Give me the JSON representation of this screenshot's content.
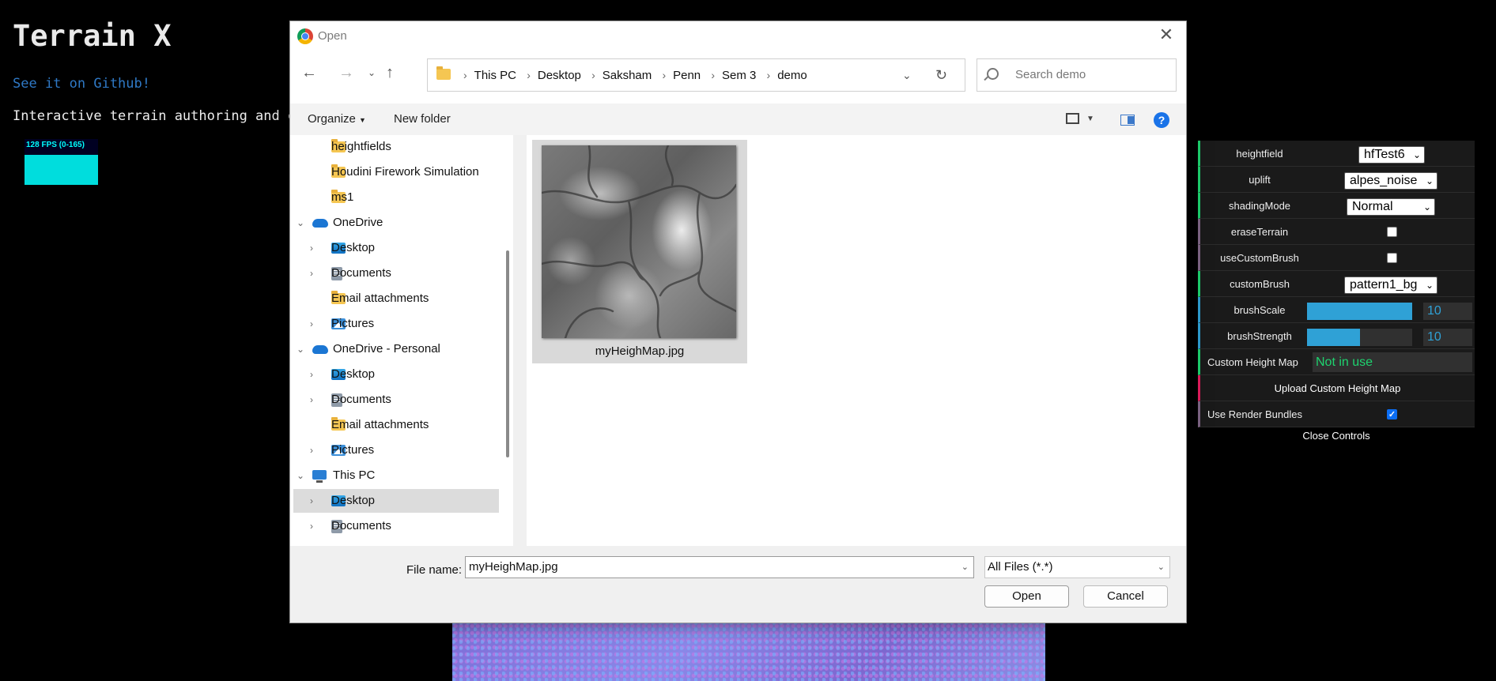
{
  "page": {
    "title": "Terrain X",
    "github_link": "See it on Github!",
    "description": "Interactive terrain authoring and e",
    "fps": "128 FPS (0-165)"
  },
  "controls": {
    "rows": {
      "heightfield": {
        "label": "heightfield",
        "value": "hfTest6"
      },
      "uplift": {
        "label": "uplift",
        "value": "alpes_noise"
      },
      "shadingMode": {
        "label": "shadingMode",
        "value": "Normal"
      },
      "eraseTerrain": {
        "label": "eraseTerrain",
        "checked": false
      },
      "useCustomBrush": {
        "label": "useCustomBrush",
        "checked": false
      },
      "customBrush": {
        "label": "customBrush",
        "value": "pattern1_bg"
      },
      "brushScale": {
        "label": "brushScale",
        "value": "10",
        "fill": 1.0
      },
      "brushStrength": {
        "label": "brushStrength",
        "value": "10",
        "fill": 0.5
      },
      "customHeightMap": {
        "label": "Custom Height Map",
        "value": "Not in use"
      },
      "uploadCustomHeightMap": {
        "label": "Upload Custom Height Map"
      },
      "useRenderBundles": {
        "label": "Use Render Bundles",
        "checked": true
      }
    },
    "close_label": "Close Controls",
    "colors": {
      "string": "#1ed36f",
      "number": "#2fa1d6",
      "boolean": "#806787",
      "function": "#e61d5f"
    }
  },
  "dialog": {
    "title": "Open",
    "breadcrumbs": [
      "This PC",
      "Desktop",
      "Saksham",
      "Penn",
      "Sem 3",
      "demo"
    ],
    "search_placeholder": "Search demo",
    "toolbar": {
      "organize": "Organize",
      "new_folder": "New folder",
      "help": "?"
    },
    "tree": [
      {
        "label": "heightfields",
        "icon": "folder-icon",
        "depth": 1
      },
      {
        "label": "Houdini Firework Simulation",
        "icon": "folder-icon",
        "depth": 1
      },
      {
        "label": "ms1",
        "icon": "folder-icon",
        "depth": 1
      },
      {
        "label": "OneDrive",
        "icon": "cloud-icon",
        "depth": 0,
        "expanded": true
      },
      {
        "label": "Desktop",
        "icon": "desktop-icon",
        "depth": 1,
        "expandable": true
      },
      {
        "label": "Documents",
        "icon": "documents-icon",
        "depth": 1,
        "expandable": true
      },
      {
        "label": "Email attachments",
        "icon": "folder-icon",
        "depth": 1
      },
      {
        "label": "Pictures",
        "icon": "pictures-icon",
        "depth": 1,
        "expandable": true
      },
      {
        "label": "OneDrive - Personal",
        "icon": "cloud-icon",
        "depth": 0,
        "expanded": true
      },
      {
        "label": "Desktop",
        "icon": "desktop-icon",
        "depth": 1,
        "expandable": true
      },
      {
        "label": "Documents",
        "icon": "documents-icon",
        "depth": 1,
        "expandable": true
      },
      {
        "label": "Email attachments",
        "icon": "folder-icon",
        "depth": 1
      },
      {
        "label": "Pictures",
        "icon": "pictures-icon",
        "depth": 1,
        "expandable": true
      },
      {
        "label": "This PC",
        "icon": "computer-icon",
        "depth": 0,
        "expanded": true
      },
      {
        "label": "Desktop",
        "icon": "desktop-icon",
        "depth": 1,
        "expandable": true,
        "selected": true
      },
      {
        "label": "Documents",
        "icon": "documents-icon",
        "depth": 1,
        "expandable": true
      }
    ],
    "file": {
      "name": "myHeighMap.jpg"
    },
    "footer": {
      "file_name_label": "File name:",
      "file_name_value": "myHeighMap.jpg",
      "file_type": "All Files (*.*)",
      "open_label": "Open",
      "cancel_label": "Cancel"
    }
  }
}
